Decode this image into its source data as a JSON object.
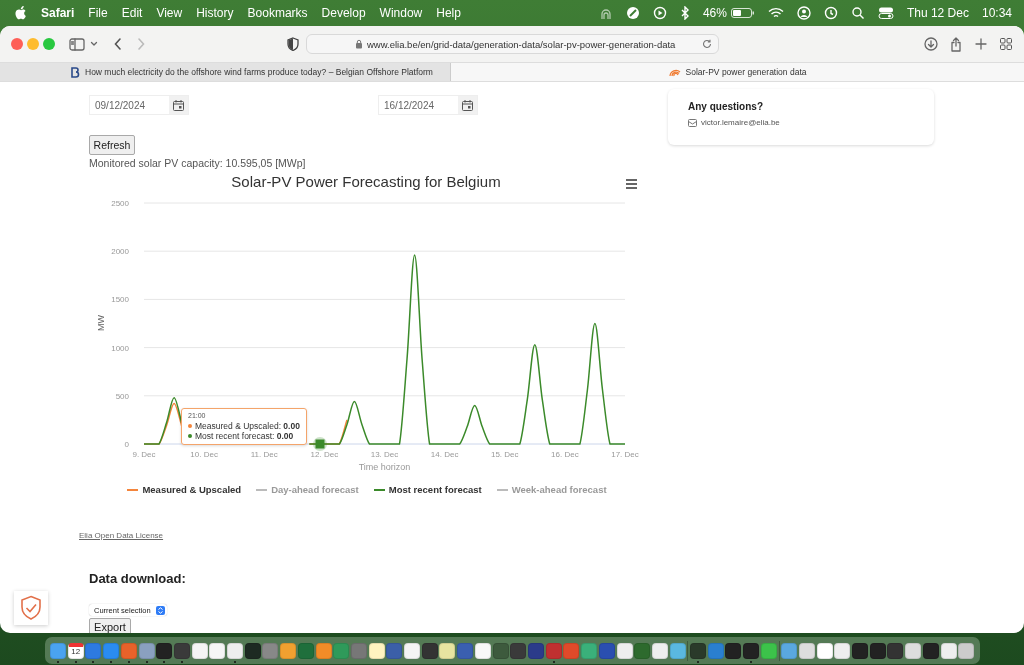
{
  "menubar": {
    "app": "Safari",
    "menus": [
      "File",
      "Edit",
      "View",
      "History",
      "Bookmarks",
      "Develop",
      "Window",
      "Help"
    ],
    "battery": "46%",
    "date": "Thu 12 Dec",
    "time": "10:34"
  },
  "browser": {
    "back": {
      "disabled": false
    },
    "forward": {
      "disabled": true
    },
    "url": "www.elia.be/en/grid-data/generation-data/solar-pv-power-generation-data",
    "tabs": [
      {
        "title": "How much electricity do the offshore wind farms produce today? – Belgian Offshore Platform",
        "selected": false
      },
      {
        "title": "Solar-PV power generation data",
        "selected": true
      }
    ]
  },
  "page": {
    "start_date": "09/12/2024",
    "end_date": "16/12/2024",
    "refresh": "Refresh",
    "capacity": "Monitored solar PV capacity: 10.595,05 [MWp]",
    "chart": {
      "chart_data": {
        "type": "line",
        "title": "Solar-PV Power Forecasting for Belgium",
        "xlabel": "Time horizon",
        "ylabel": "MW",
        "grid": true,
        "categories": [
          "9. Dec",
          null,
          null,
          null,
          null,
          null,
          null,
          null,
          "10. Dec",
          null,
          null,
          null,
          null,
          null,
          null,
          null,
          "11. Dec",
          null,
          null,
          null,
          null,
          null,
          null,
          null,
          "12. Dec",
          null,
          null,
          null,
          null,
          null,
          null,
          null,
          "13. Dec",
          null,
          null,
          null,
          null,
          null,
          null,
          null,
          "14. Dec",
          null,
          null,
          null,
          null,
          null,
          null,
          null,
          "15. Dec",
          null,
          null,
          null,
          null,
          null,
          null,
          null,
          "16. Dec",
          null,
          null,
          null,
          null,
          null,
          null,
          null,
          "17. Dec"
        ],
        "ylim": [
          0,
          2500
        ],
        "yticks": [
          0,
          500,
          1000,
          1500,
          2000,
          2500
        ],
        "series": [
          {
            "name": "Measured & Upscaled",
            "color": "#f4853c",
            "values": [
              0,
              0,
              0,
              190,
              420,
              190,
              null,
              null,
              null,
              null,
              null,
              null,
              null,
              null,
              null,
              null,
              null,
              null,
              null,
              null,
              null,
              null,
              0,
              0,
              0,
              0,
              0,
              250,
              null,
              null,
              null,
              null,
              null,
              null,
              null,
              null,
              null,
              null,
              null,
              null,
              null,
              null,
              null,
              null,
              null,
              null,
              null,
              null,
              null,
              null,
              null,
              null,
              null,
              null,
              null,
              null,
              null,
              null,
              null,
              null,
              null,
              null,
              null,
              null,
              null
            ]
          },
          {
            "name": "Day-ahead forecast",
            "values": [
              null,
              null,
              null,
              null,
              null,
              null,
              null,
              null,
              null,
              null,
              null,
              null,
              null,
              null,
              null,
              null,
              null,
              null,
              null,
              null,
              null,
              null,
              null,
              null,
              null,
              null,
              null,
              null,
              null,
              null,
              null,
              null,
              null,
              null,
              null,
              null,
              null,
              null,
              null,
              null,
              null,
              null,
              null,
              null,
              null,
              null,
              null,
              null,
              null,
              null,
              null,
              null,
              null,
              null,
              null,
              null,
              null,
              null,
              null,
              null,
              null,
              null,
              null,
              null,
              null
            ]
          },
          {
            "name": "Most recent forecast",
            "color": "#3b8a2a",
            "values": [
              0,
              0,
              0,
              220,
              480,
              220,
              null,
              null,
              null,
              null,
              null,
              null,
              null,
              null,
              null,
              null,
              null,
              null,
              null,
              null,
              null,
              null,
              0,
              0,
              0,
              0,
              0,
              200,
              440,
              200,
              0,
              0,
              0,
              0,
              0,
              880,
              1960,
              880,
              0,
              0,
              0,
              0,
              0,
              180,
              400,
              180,
              0,
              0,
              0,
              0,
              0,
              460,
              1030,
              460,
              0,
              0,
              0,
              0,
              0,
              560,
              1250,
              560,
              0,
              0,
              0
            ]
          },
          {
            "name": "Week-ahead forecast",
            "values": [
              null,
              null,
              null,
              null,
              null,
              null,
              null,
              null,
              null,
              null,
              null,
              null,
              null,
              null,
              null,
              null,
              null,
              null,
              null,
              null,
              null,
              null,
              null,
              null,
              null,
              null,
              null,
              null,
              null,
              null,
              null,
              null,
              null,
              null,
              null,
              null,
              null,
              null,
              null,
              null,
              null,
              null,
              null,
              null,
              null,
              null,
              null,
              null,
              null,
              null,
              null,
              null,
              null,
              null,
              null,
              null,
              null,
              null,
              null,
              null,
              null,
              null,
              null,
              null,
              null
            ]
          }
        ]
      },
      "legend": [
        {
          "enabled": true
        },
        {
          "enabled": false
        },
        {
          "enabled": true
        },
        {
          "enabled": false
        }
      ],
      "tooltip": {
        "time": "21:00",
        "rows": [
          {
            "text": "Measured & Upscaled: **0.00**",
            "color": "#f4853c"
          },
          {
            "text": "Most recent forecast: **0.00**",
            "color": "#3b8a2a"
          }
        ]
      }
    },
    "license": "Elia Open Data License",
    "download_heading": "Data download:",
    "selection": "Current selection",
    "export": "Export",
    "contact": {
      "heading": "Any questions?",
      "email": "victor.lemaire@elia.be"
    }
  },
  "dock": {
    "groups": [
      [
        {
          "kind": "app",
          "running": true
        },
        {
          "kind": "calendar",
          "label": "12",
          "running": true
        },
        {
          "kind": "app",
          "running": true
        },
        {
          "kind": "app",
          "running": true
        },
        {
          "kind": "app",
          "running": true
        },
        {
          "kind": "app",
          "running": true
        },
        {
          "kind": "app",
          "running": true
        },
        {
          "kind": "app",
          "running": true
        },
        {
          "kind": "app"
        },
        {
          "kind": "app"
        },
        {
          "kind": "app",
          "running": true
        },
        {
          "kind": "app"
        },
        {
          "kind": "app"
        },
        {
          "kind": "app"
        },
        {
          "kind": "app"
        },
        {
          "kind": "app"
        },
        {
          "kind": "app"
        },
        {
          "kind": "app"
        },
        {
          "kind": "app"
        },
        {
          "kind": "app"
        },
        {
          "kind": "app"
        },
        {
          "kind": "app"
        },
        {
          "kind": "app"
        },
        {
          "kind": "app"
        },
        {
          "kind": "app"
        },
        {
          "kind": "app"
        },
        {
          "kind": "app"
        },
        {
          "kind": "app"
        },
        {
          "kind": "app",
          "running": true
        },
        {
          "kind": "app"
        },
        {
          "kind": "app"
        },
        {
          "kind": "app"
        },
        {
          "kind": "app"
        },
        {
          "kind": "app"
        },
        {
          "kind": "app"
        },
        {
          "kind": "app"
        }
      ],
      [
        {
          "kind": "app",
          "running": true
        },
        {
          "kind": "app"
        },
        {
          "kind": "app"
        },
        {
          "kind": "app",
          "running": true
        },
        {
          "kind": "app"
        }
      ],
      [
        {
          "kind": "app"
        },
        {
          "kind": "app"
        },
        {
          "kind": "app"
        },
        {
          "kind": "app"
        },
        {
          "kind": "app"
        },
        {
          "kind": "app"
        },
        {
          "kind": "app"
        },
        {
          "kind": "app"
        },
        {
          "kind": "app"
        },
        {
          "kind": "app"
        },
        {
          "kind": "app"
        }
      ]
    ]
  }
}
